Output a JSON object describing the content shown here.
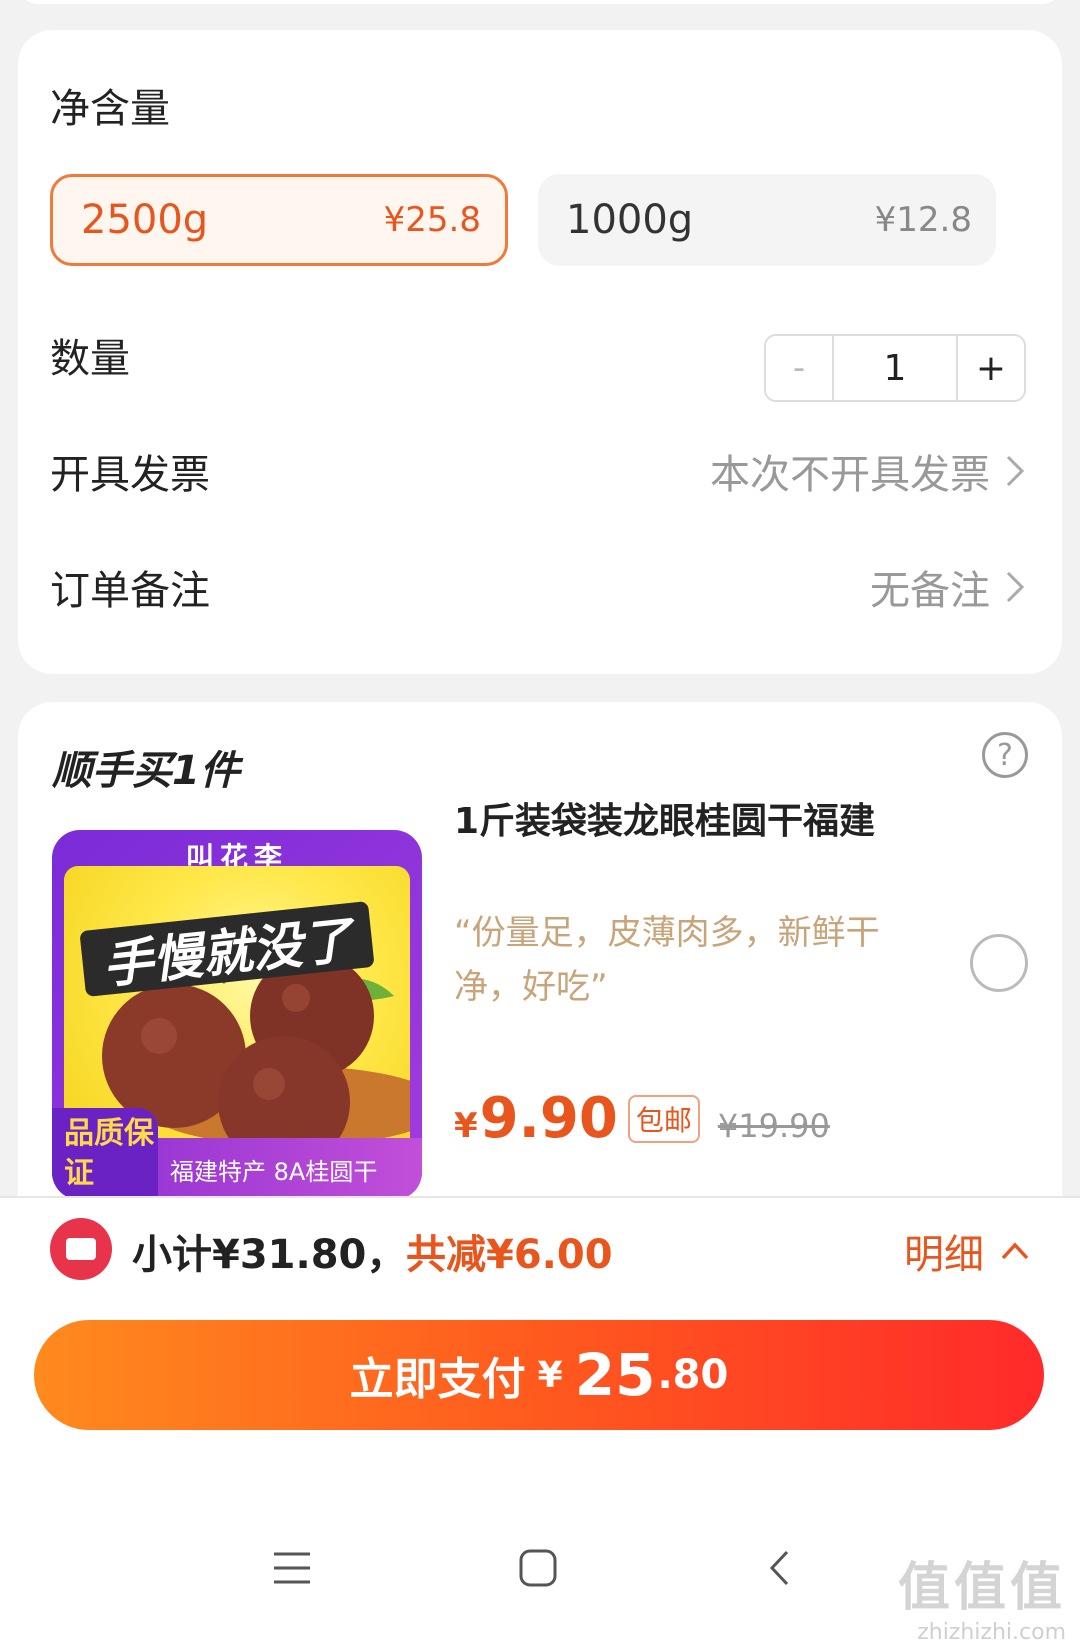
{
  "spec": {
    "title": "净含量",
    "options": [
      {
        "name": "2500g",
        "price": "¥25.8",
        "selected": true
      },
      {
        "name": "1000g",
        "price": "¥12.8",
        "selected": false
      }
    ]
  },
  "quantity": {
    "label": "数量",
    "minus": "-",
    "value": "1",
    "plus": "+"
  },
  "invoice": {
    "label": "开具发票",
    "value": "本次不开具发票"
  },
  "remark": {
    "label": "订单备注",
    "value": "无备注"
  },
  "addon": {
    "title": "顺手买1件",
    "help": "?",
    "product": {
      "image_brand": "叫花李",
      "image_banner": "手慢就没了",
      "image_quality": "品质保证",
      "image_caption": "福建特产 8A桂圆干",
      "title": "1斤装袋装龙眼桂圆干福建",
      "review": "“份量足，皮薄肉多，新鲜干净，好吃”",
      "price_symbol": "¥",
      "price": "9.90",
      "shipping_tag": "包邮",
      "original_price": "¥19.90"
    }
  },
  "footer": {
    "subtotal": "小计¥31.80，",
    "discount": "共减¥6.00",
    "detail": "明细",
    "pay_label": "立即支付",
    "pay_symbol": "¥",
    "pay_int": "25",
    "pay_dec": ".80"
  },
  "watermark": {
    "logo": "值值值",
    "site": "zhizhizhi.com"
  },
  "colors": {
    "accent": "#e8561e",
    "pay_gradient_start": "#ff8a1e",
    "pay_gradient_end": "#ff2a2a"
  }
}
